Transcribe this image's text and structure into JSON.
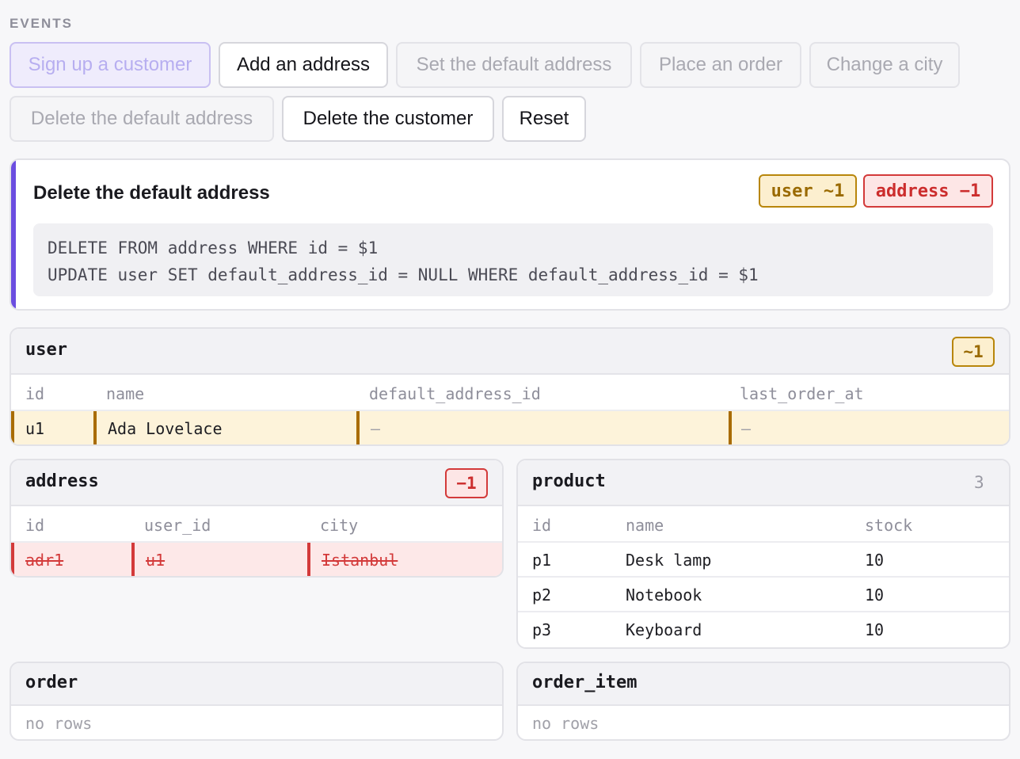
{
  "events": {
    "label": "EVENTS",
    "buttons": [
      {
        "label": "Sign up a customer",
        "state": "active"
      },
      {
        "label": "Add an address",
        "state": "enabled"
      },
      {
        "label": "Set the default address",
        "state": "disabled"
      },
      {
        "label": "Place an order",
        "state": "disabled"
      },
      {
        "label": "Change a city",
        "state": "disabled"
      },
      {
        "label": "Delete the default address",
        "state": "disabled"
      },
      {
        "label": "Delete the customer",
        "state": "enabled"
      },
      {
        "label": "Reset",
        "state": "enabled"
      }
    ]
  },
  "current_event": {
    "title": "Delete the default address",
    "tags": [
      {
        "label": "user ~1",
        "kind": "modified"
      },
      {
        "label": "address −1",
        "kind": "deleted"
      }
    ],
    "sql": [
      "DELETE FROM address WHERE id = $1",
      "UPDATE user SET default_address_id = NULL WHERE default_address_id = $1"
    ]
  },
  "tables": {
    "user": {
      "name": "user",
      "badge": "~1",
      "columns": [
        "id",
        "name",
        "default_address_id",
        "last_order_at"
      ],
      "rows": [
        {
          "state": "modified",
          "cells": [
            "u1",
            "Ada Lovelace",
            "—",
            "—"
          ]
        }
      ]
    },
    "address": {
      "name": "address",
      "badge": "−1",
      "columns": [
        "id",
        "user_id",
        "city"
      ],
      "rows": [
        {
          "state": "deleted",
          "cells": [
            "adr1",
            "u1",
            "Istanbul"
          ]
        }
      ]
    },
    "product": {
      "name": "product",
      "count": "3",
      "columns": [
        "id",
        "name",
        "stock"
      ],
      "rows": [
        {
          "cells": [
            "p1",
            "Desk lamp",
            "10"
          ]
        },
        {
          "cells": [
            "p2",
            "Notebook",
            "10"
          ]
        },
        {
          "cells": [
            "p3",
            "Keyboard",
            "10"
          ]
        }
      ]
    },
    "order": {
      "name": "order",
      "empty": "no rows"
    },
    "order_item": {
      "name": "order_item",
      "empty": "no rows"
    }
  }
}
